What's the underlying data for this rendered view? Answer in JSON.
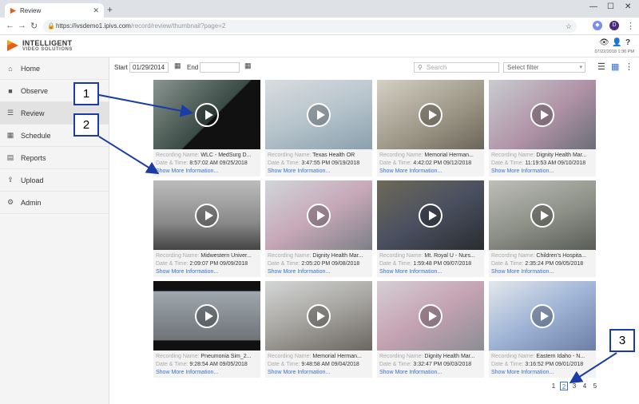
{
  "browser": {
    "tab_title": "Review",
    "url_host": "https://ivsdemo1.ipivs.com",
    "url_path": "/record/review/thumbnail?page=2"
  },
  "header": {
    "logo_line1": "INTELLIGENT",
    "logo_line2": "VIDEO SOLUTIONS",
    "datetime": "07/22/2018 1:30 PM",
    "profile_initial": "D"
  },
  "sidebar": {
    "items": [
      {
        "label": "Home",
        "icon": "home-icon"
      },
      {
        "label": "Observe",
        "icon": "camera-icon"
      },
      {
        "label": "Review",
        "icon": "list-icon"
      },
      {
        "label": "Schedule",
        "icon": "calendar-icon"
      },
      {
        "label": "Reports",
        "icon": "chart-icon"
      },
      {
        "label": "Upload",
        "icon": "upload-icon"
      },
      {
        "label": "Admin",
        "icon": "gear-icon"
      }
    ],
    "active": "Review"
  },
  "filter": {
    "start_label": "Start",
    "start_value": "01/29/2014",
    "end_label": "End",
    "end_value": "",
    "search_placeholder": "Search",
    "select_value": "Select filter"
  },
  "meta_labels": {
    "name": "Recording Name:",
    "date": "Date & Time:",
    "more": "Show More Information..."
  },
  "recordings": [
    {
      "name": "WLC - MedSurg D...",
      "datetime": "8:57:02 AM 09/25/2018"
    },
    {
      "name": "Texas Health OR",
      "datetime": "3:47:55 PM 09/19/2018"
    },
    {
      "name": "Memorial Herman...",
      "datetime": "4:42:02 PM 09/12/2018"
    },
    {
      "name": "Dignity Health Mar...",
      "datetime": "11:19:53 AM 09/10/2018"
    },
    {
      "name": "Midwestern Univer...",
      "datetime": "2:09:07 PM 09/09/2018"
    },
    {
      "name": "Dignity Health Mar...",
      "datetime": "2:05:20 PM 09/08/2018"
    },
    {
      "name": "Mt. Royal U - Nurs...",
      "datetime": "1:59:48 PM 09/07/2018"
    },
    {
      "name": "Children's Hospita...",
      "datetime": "2:35:24 PM 09/05/2018"
    },
    {
      "name": "Pneumonia Sim_2...",
      "datetime": "9:28:54 AM 09/05/2018"
    },
    {
      "name": "Memorial Herman...",
      "datetime": "9:48:58 AM 09/04/2018"
    },
    {
      "name": "Dignity Health Mar...",
      "datetime": "3:32:47 PM 09/03/2018"
    },
    {
      "name": "Eastern Idaho - N...",
      "datetime": "3:16:52 PM 09/01/2018"
    }
  ],
  "pager": {
    "pages": [
      "1",
      "2",
      "3",
      "4",
      "5"
    ],
    "current": "2"
  },
  "callouts": [
    "1",
    "2",
    "3"
  ]
}
